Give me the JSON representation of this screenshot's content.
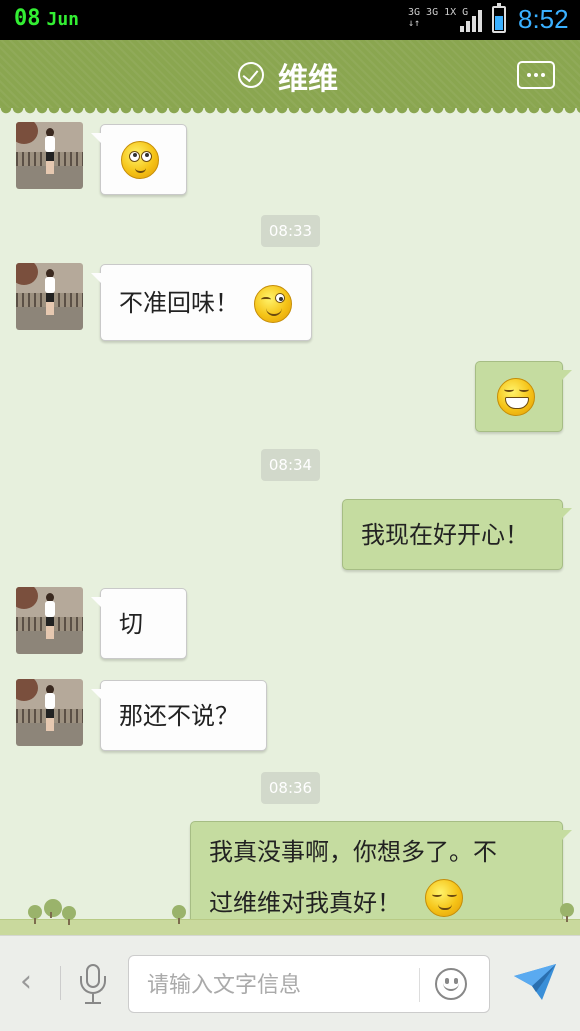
{
  "status_bar": {
    "day": "08",
    "month": "Jun",
    "network": [
      "3G 3G 1X G",
      "↓↑"
    ],
    "time": "8:52",
    "battery_level": 0.6,
    "battery_color": "#3ab0ff"
  },
  "header": {
    "title": "维维",
    "status_icon": "check-circle-icon",
    "menu_icon": "more-icon",
    "bg_color": "#8aa650"
  },
  "messages": [
    {
      "side": "left",
      "type": "emoji",
      "emoji": "rolling-eyes-emoji"
    },
    {
      "type": "timestamp",
      "text": "08:33"
    },
    {
      "side": "left",
      "type": "text",
      "text": "不准回味！",
      "emoji": "wink-emoji"
    },
    {
      "side": "right",
      "type": "emoji",
      "emoji": "grin-emoji"
    },
    {
      "type": "timestamp",
      "text": "08:34"
    },
    {
      "side": "right",
      "type": "text",
      "text": "我现在好开心！"
    },
    {
      "side": "left",
      "type": "text",
      "text": "切"
    },
    {
      "side": "left",
      "type": "text",
      "text": "那还不说？"
    },
    {
      "type": "timestamp",
      "text": "08:36"
    },
    {
      "side": "right",
      "type": "text",
      "text": [
        "我真没事啊，你想多了。不",
        "过维维对我真好！"
      ],
      "emoji": "content-smile-emoji"
    }
  ],
  "input_bar": {
    "back_label": "‹",
    "placeholder": "请输入文字信息",
    "value": "",
    "icons": [
      "chevron-left-icon",
      "microphone-icon",
      "smiley-icon",
      "send-icon"
    ]
  },
  "colors": {
    "chat_bg": "#e7f0dd",
    "bubble_self": "#c5dca0",
    "bubble_other": "#fdfdfd"
  }
}
